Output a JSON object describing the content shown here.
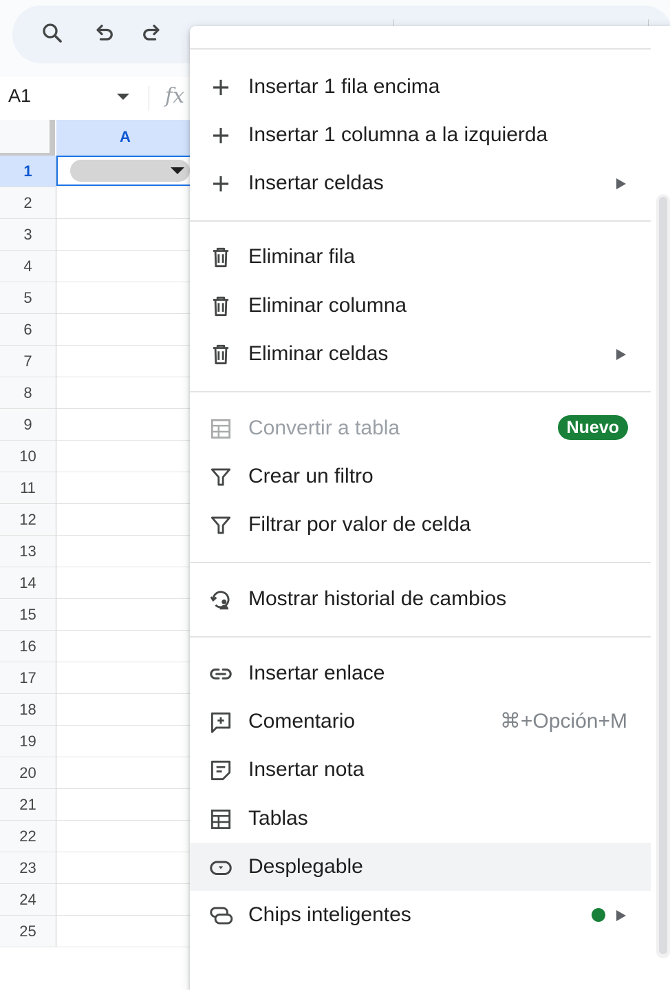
{
  "toolbar": {
    "icons": [
      "search-icon",
      "undo-icon",
      "redo-icon"
    ]
  },
  "formula_bar": {
    "name_box": "A1",
    "fx": "fx"
  },
  "grid": {
    "column_header": "A",
    "rows": [
      "1",
      "2",
      "3",
      "4",
      "5",
      "6",
      "7",
      "8",
      "9",
      "10",
      "11",
      "12",
      "13",
      "14",
      "15",
      "16",
      "17",
      "18",
      "19",
      "20",
      "21",
      "22",
      "23",
      "24",
      "25"
    ],
    "selected_row": "1",
    "selected_cell": "A1"
  },
  "menu": {
    "groups": [
      [
        {
          "label": "Insertar 1 fila encima",
          "icon": "plus-icon"
        },
        {
          "label": "Insertar 1 columna a la izquierda",
          "icon": "plus-icon"
        },
        {
          "label": "Insertar celdas",
          "icon": "plus-icon",
          "submenu": true
        }
      ],
      [
        {
          "label": "Eliminar fila",
          "icon": "trash-icon"
        },
        {
          "label": "Eliminar columna",
          "icon": "trash-icon"
        },
        {
          "label": "Eliminar celdas",
          "icon": "trash-icon",
          "submenu": true
        }
      ],
      [
        {
          "label": "Convertir a tabla",
          "icon": "table-icon",
          "disabled": true,
          "badge": "Nuevo"
        },
        {
          "label": "Crear un filtro",
          "icon": "filter-icon"
        },
        {
          "label": "Filtrar por valor de celda",
          "icon": "filter-icon"
        }
      ],
      [
        {
          "label": "Mostrar historial de cambios",
          "icon": "history-icon"
        }
      ],
      [
        {
          "label": "Insertar enlace",
          "icon": "link-icon"
        },
        {
          "label": "Comentario",
          "icon": "comment-icon",
          "shortcut": "⌘+Opción+M"
        },
        {
          "label": "Insertar nota",
          "icon": "note-icon"
        },
        {
          "label": "Tablas",
          "icon": "table-icon"
        },
        {
          "label": "Desplegable",
          "icon": "dropdown-icon",
          "hovered": true
        },
        {
          "label": "Chips inteligentes",
          "icon": "smart-chip-icon",
          "submenu": true,
          "new_dot": true
        }
      ]
    ]
  },
  "colors": {
    "accent": "#0b57d0",
    "selection": "#d3e3fd",
    "badge_green": "#188038"
  }
}
